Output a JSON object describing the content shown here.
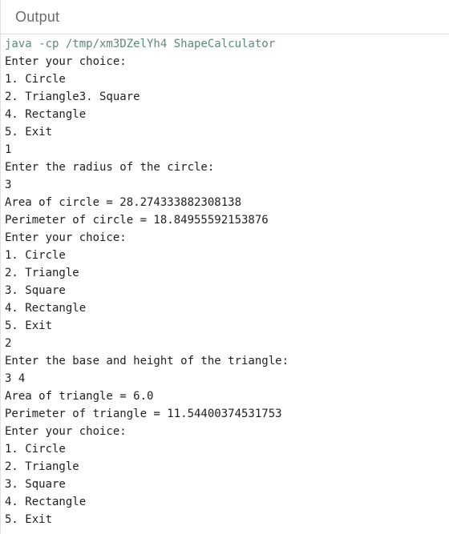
{
  "header": {
    "title": "Output"
  },
  "console": {
    "lines": [
      {
        "text": "java -cp /tmp/xm3DZelYh4 ShapeCalculator",
        "kind": "command"
      },
      {
        "text": "Enter your choice:",
        "kind": "output"
      },
      {
        "text": "1. Circle",
        "kind": "output"
      },
      {
        "text": "2. Triangle3. Square",
        "kind": "output"
      },
      {
        "text": "4. Rectangle",
        "kind": "output"
      },
      {
        "text": "5. Exit",
        "kind": "output"
      },
      {
        "text": "1",
        "kind": "input"
      },
      {
        "text": "Enter the radius of the circle:",
        "kind": "output"
      },
      {
        "text": "3",
        "kind": "input"
      },
      {
        "text": "Area of circle = 28.274333882308138",
        "kind": "output"
      },
      {
        "text": "Perimeter of circle = 18.84955592153876",
        "kind": "output"
      },
      {
        "text": "Enter your choice:",
        "kind": "output"
      },
      {
        "text": "1. Circle",
        "kind": "output"
      },
      {
        "text": "2. Triangle",
        "kind": "output"
      },
      {
        "text": "3. Square",
        "kind": "output"
      },
      {
        "text": "4. Rectangle",
        "kind": "output"
      },
      {
        "text": "5. Exit",
        "kind": "output"
      },
      {
        "text": "2",
        "kind": "input"
      },
      {
        "text": "Enter the base and height of the triangle:",
        "kind": "output"
      },
      {
        "text": "3 4",
        "kind": "input"
      },
      {
        "text": "Area of triangle = 6.0",
        "kind": "output"
      },
      {
        "text": "Perimeter of triangle = 11.54400374531753",
        "kind": "output"
      },
      {
        "text": "Enter your choice:",
        "kind": "output"
      },
      {
        "text": "1. Circle",
        "kind": "output"
      },
      {
        "text": "2. Triangle",
        "kind": "output"
      },
      {
        "text": "3. Square",
        "kind": "output"
      },
      {
        "text": "4. Rectangle",
        "kind": "output"
      },
      {
        "text": "5. Exit",
        "kind": "output"
      }
    ]
  },
  "colors": {
    "command_text": "#5a8a7c",
    "output_text": "#1f1f1f",
    "header_text": "#6b6b6b"
  }
}
